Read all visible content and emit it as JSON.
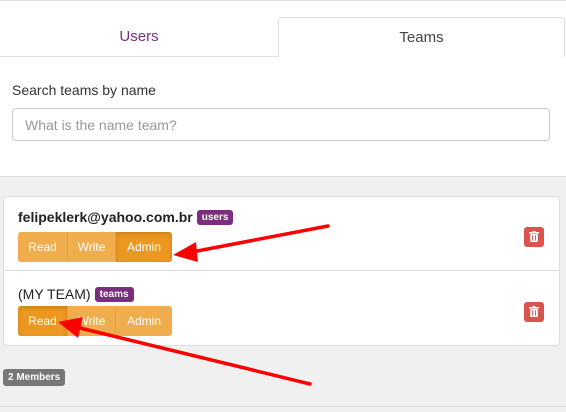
{
  "tabs": {
    "users": "Users",
    "teams": "Teams"
  },
  "search": {
    "label": "Search teams by name",
    "placeholder": "What is the name team?"
  },
  "members": [
    {
      "name": "felipeklerk@yahoo.com.br",
      "badge": "users",
      "active_permission": "Admin"
    },
    {
      "name": "(MY TEAM)",
      "badge": "teams",
      "active_permission": "Read"
    }
  ],
  "permissions": {
    "read": "Read",
    "write": "Write",
    "admin": "Admin"
  },
  "members_count": "2 Members",
  "colors": {
    "accent_purple": "#7b2d7e",
    "permission_orange": "#f0ad4e",
    "permission_active": "#ec971f",
    "delete_red": "#d9534f",
    "annotation_arrow": "#ff0000"
  },
  "icons": {
    "delete": "trash-icon"
  }
}
